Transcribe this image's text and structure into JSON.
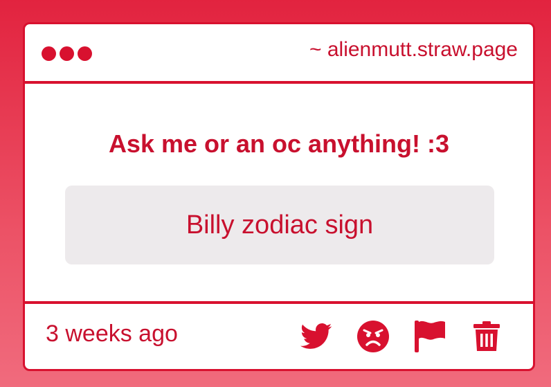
{
  "window": {
    "url": "~ alienmutt.straw.page",
    "dots": 3
  },
  "question": {
    "title": "Ask me or an oc anything! :3",
    "text": "Billy zodiac sign"
  },
  "footer": {
    "timestamp": "3 weeks ago",
    "actions": [
      {
        "name": "twitter-share-button",
        "icon": "twitter-bird-icon"
      },
      {
        "name": "react-angry-button",
        "icon": "angry-face-icon"
      },
      {
        "name": "report-button",
        "icon": "flag-icon"
      },
      {
        "name": "delete-button",
        "icon": "trash-icon"
      }
    ]
  },
  "colors": {
    "accent": "#d8112f",
    "text": "#c8102e",
    "answer_bg": "#edeaec",
    "background_top": "#e2233f",
    "background_bottom": "#f06b7d"
  }
}
